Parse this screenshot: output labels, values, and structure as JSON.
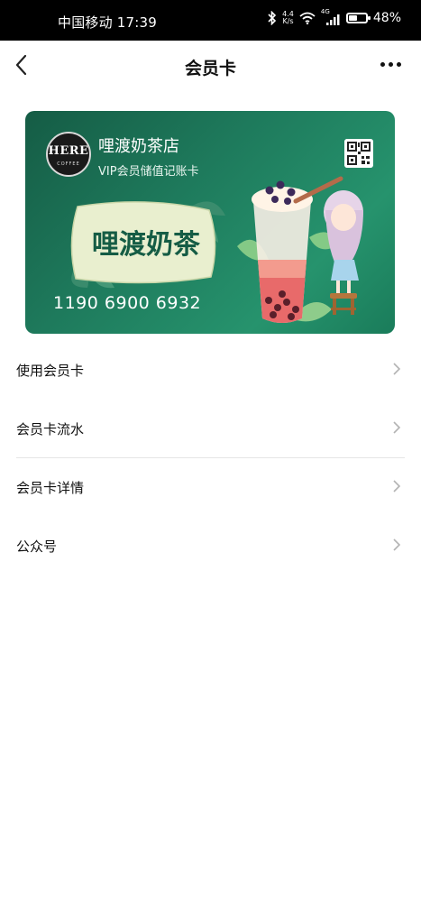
{
  "status": {
    "carrier_time": "中国移动 17:39",
    "net_speed_value": "4.4",
    "net_speed_unit": "K/s",
    "network_badge": "4G",
    "battery_percent_text": "48%",
    "battery_level": 0.48
  },
  "nav": {
    "title": "会员卡"
  },
  "card": {
    "logo_text": "HERE",
    "logo_subtext": "COFFEE",
    "store_name": "哩渡奶茶店",
    "subtitle": "VIP会员储值记账卡",
    "banner_text": "哩渡奶茶",
    "card_number": "1190 6900 6932"
  },
  "menu": {
    "items": [
      {
        "label": "使用会员卡"
      },
      {
        "label": "会员卡流水"
      },
      {
        "label": "会员卡详情"
      },
      {
        "label": "公众号"
      }
    ]
  },
  "colors": {
    "card_green": "#1e7a5c",
    "card_banner": "#e9efcf",
    "divider": "#e6e6e6"
  }
}
